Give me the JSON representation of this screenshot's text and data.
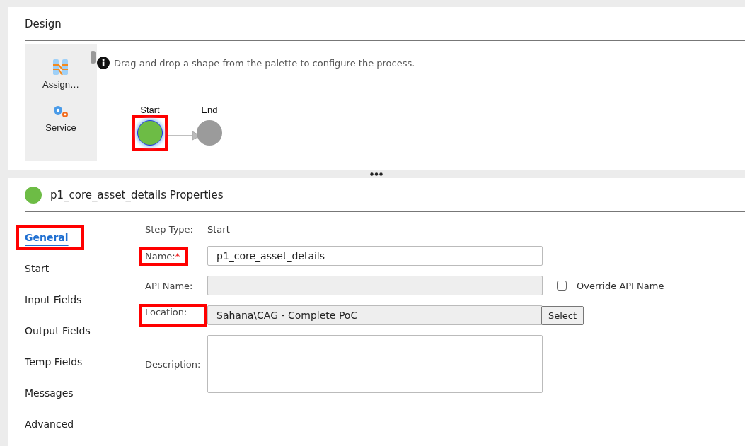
{
  "design": {
    "title": "Design",
    "palette": [
      {
        "kind": "assignment",
        "label": "Assign…"
      },
      {
        "kind": "service",
        "label": "Service"
      }
    ],
    "hint": "Drag and drop a shape from the palette to configure the process.",
    "nodes": [
      {
        "kind": "start",
        "label": "Start",
        "selected": true,
        "highlighted": true
      },
      {
        "kind": "end",
        "label": "End",
        "selected": false,
        "highlighted": false
      }
    ]
  },
  "properties": {
    "title": "p1_core_asset_details Properties",
    "tabs": [
      {
        "label": "General",
        "selected": true,
        "highlighted": true
      },
      {
        "label": "Start",
        "selected": false,
        "highlighted": false
      },
      {
        "label": "Input Fields",
        "selected": false,
        "highlighted": false
      },
      {
        "label": "Output Fields",
        "selected": false,
        "highlighted": false
      },
      {
        "label": "Temp Fields",
        "selected": false,
        "highlighted": false
      },
      {
        "label": "Messages",
        "selected": false,
        "highlighted": false
      },
      {
        "label": "Advanced",
        "selected": false,
        "highlighted": false
      }
    ],
    "fields": [
      {
        "kind": "text",
        "label": "Step Type:",
        "value": "Start"
      },
      {
        "kind": "input",
        "label": "Name:",
        "required_mark": "*",
        "disabled": false,
        "value": "p1_core_asset_details",
        "highlighted": true
      },
      {
        "kind": "input",
        "label": "API Name:",
        "disabled": true,
        "checkbox": {
          "label": "Override API Name",
          "checked": false
        },
        "highlighted": false
      },
      {
        "kind": "input",
        "label": "Location:",
        "disabled": true,
        "value": "Sahana\\CAG - Complete PoC",
        "button": "Select",
        "highlighted": true
      },
      {
        "kind": "textarea",
        "label": "Description:"
      }
    ]
  }
}
